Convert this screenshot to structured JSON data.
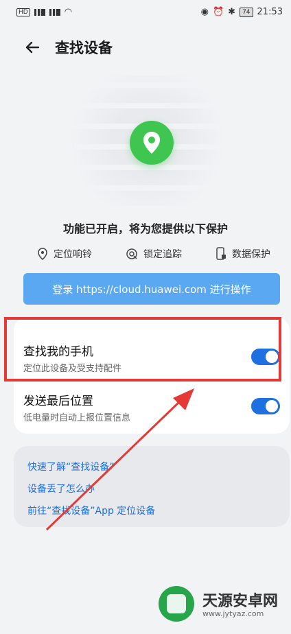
{
  "statusbar": {
    "time": "21:53",
    "battery": "74",
    "left_labels": [
      "HD",
      "HD"
    ]
  },
  "header": {
    "title": "查找设备"
  },
  "hero": {
    "status_text": "功能已开启，将为您提供以下保护",
    "features": [
      {
        "label": "定位响铃",
        "icon": "location-pin-icon"
      },
      {
        "label": "锁定追踪",
        "icon": "lock-track-icon"
      },
      {
        "label": "数据保护",
        "icon": "phone-lock-icon"
      }
    ],
    "login_button": "登录 https://cloud.huawei.com 进行操作"
  },
  "settings": [
    {
      "title": "查找我的手机",
      "subtitle": "定位此设备及受支持配件",
      "enabled": true
    },
    {
      "title": "发送最后位置",
      "subtitle": "低电量时自动上报位置信息",
      "enabled": true
    }
  ],
  "links": [
    "快速了解“查找设备”",
    "设备丢了怎么办",
    "前往“查找设备”App 定位设备"
  ],
  "watermark": {
    "name": "天源安卓网",
    "url": "www.jytyaz.com"
  },
  "colors": {
    "accent": "#1e6fe0",
    "pin": "#3fc651",
    "login": "#5aa7f2",
    "highlight": "#e53935"
  }
}
